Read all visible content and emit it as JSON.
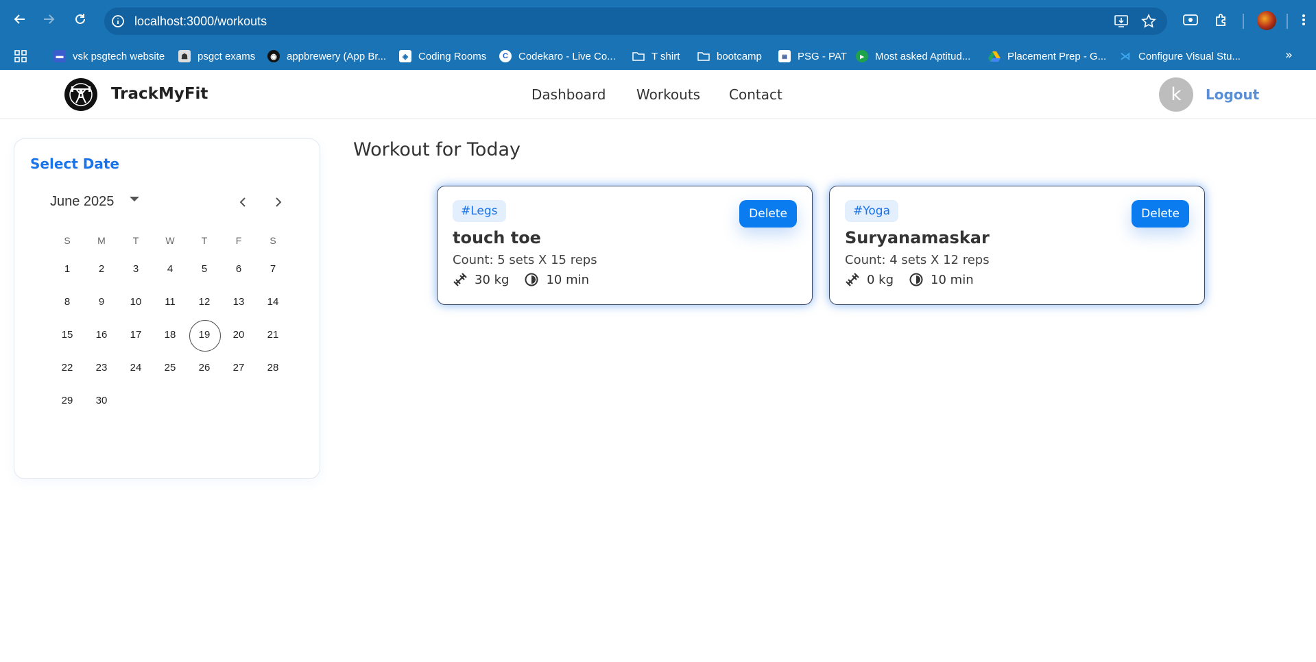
{
  "browser": {
    "url": "localhost:3000/workouts",
    "bookmarks": [
      {
        "label": "vsk psgtech website",
        "icon": "site-icon"
      },
      {
        "label": "psgct exams",
        "icon": "site-icon"
      },
      {
        "label": "appbrewery (App Br...",
        "icon": "site-icon"
      },
      {
        "label": "Coding Rooms",
        "icon": "site-icon"
      },
      {
        "label": "Codekaro - Live Co...",
        "icon": "site-icon"
      },
      {
        "label": "T shirt",
        "icon": "folder-icon"
      },
      {
        "label": "bootcamp",
        "icon": "folder-icon"
      },
      {
        "label": "PSG - PAT",
        "icon": "site-icon"
      },
      {
        "label": "Most asked Aptitud...",
        "icon": "site-icon"
      },
      {
        "label": "Placement Prep - G...",
        "icon": "drive-icon"
      },
      {
        "label": "Configure Visual Stu...",
        "icon": "vscode-icon"
      }
    ]
  },
  "header": {
    "brand": "TrackMyFit",
    "nav": [
      "Dashboard",
      "Workouts",
      "Contact"
    ],
    "avatar_letter": "k",
    "logout": "Logout"
  },
  "calendar": {
    "title": "Select Date",
    "month_label": "June 2025",
    "weekdays": [
      "S",
      "M",
      "T",
      "W",
      "T",
      "F",
      "S"
    ],
    "weeks": [
      [
        "1",
        "2",
        "3",
        "4",
        "5",
        "6",
        "7"
      ],
      [
        "8",
        "9",
        "10",
        "11",
        "12",
        "13",
        "14"
      ],
      [
        "15",
        "16",
        "17",
        "18",
        "19",
        "20",
        "21"
      ],
      [
        "22",
        "23",
        "24",
        "25",
        "26",
        "27",
        "28"
      ],
      [
        "29",
        "30",
        "",
        "",
        "",
        "",
        ""
      ]
    ],
    "selected_day": "19"
  },
  "main": {
    "title": "Workout for Today",
    "workouts": [
      {
        "tag": "#Legs",
        "name": "touch toe",
        "count": "Count: 5 sets X 15 reps",
        "weight": "30 kg",
        "duration": "10 min",
        "delete_label": "Delete"
      },
      {
        "tag": "#Yoga",
        "name": "Suryanamaskar",
        "count": "Count: 4 sets X 12 reps",
        "weight": "0 kg",
        "duration": "10 min",
        "delete_label": "Delete"
      }
    ]
  },
  "colors": {
    "chrome": "#1a73b5",
    "accent": "#1a73e8",
    "delete_button": "#0a7cf0",
    "logout": "#5a8fd6"
  }
}
